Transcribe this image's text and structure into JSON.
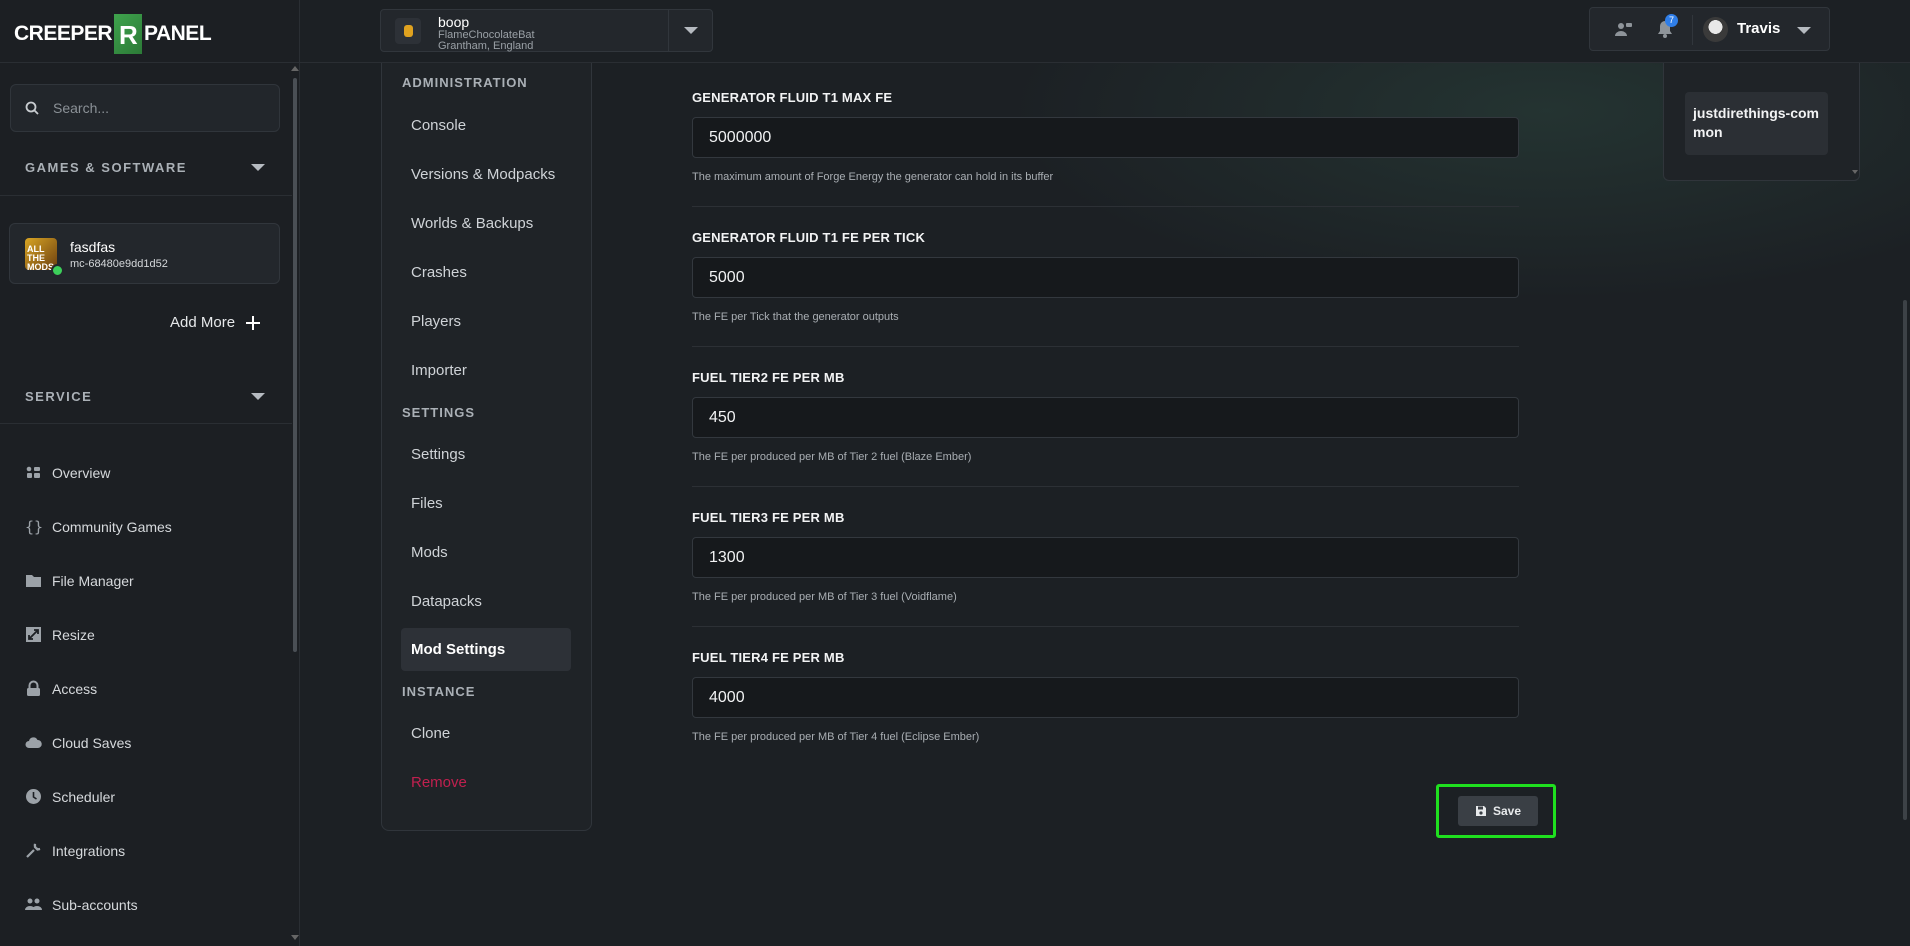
{
  "brand": {
    "logo_left": "CREEPER",
    "logo_right": "PANEL"
  },
  "search": {
    "placeholder": "Search..."
  },
  "sidebar": {
    "games_section": "GAMES & SOFTWARE",
    "server": {
      "name": "fasdfas",
      "id": "mc-68480e9dd1d52",
      "thumb_text": "ALL THE MODS"
    },
    "add_more": "Add More",
    "service_section": "SERVICE",
    "items": [
      {
        "label": "Overview",
        "icon": "grid-icon"
      },
      {
        "label": "Community Games",
        "icon": "braces-icon"
      },
      {
        "label": "File Manager",
        "icon": "folder-icon"
      },
      {
        "label": "Resize",
        "icon": "resize-icon"
      },
      {
        "label": "Access",
        "icon": "lock-icon"
      },
      {
        "label": "Cloud Saves",
        "icon": "cloud-icon"
      },
      {
        "label": "Scheduler",
        "icon": "clock-icon"
      },
      {
        "label": "Integrations",
        "icon": "wrench-icon"
      },
      {
        "label": "Sub-accounts",
        "icon": "users-icon"
      }
    ]
  },
  "header": {
    "server_name": "boop",
    "server_host": "FlameChocolateBat",
    "server_location": "Grantham, England",
    "notifications": "7",
    "username": "Travis"
  },
  "subnav": {
    "administration": "ADMINISTRATION",
    "admin_items": [
      "Console",
      "Versions & Modpacks",
      "Worlds & Backups",
      "Crashes",
      "Players",
      "Importer"
    ],
    "settings": "SETTINGS",
    "settings_items": [
      "Settings",
      "Files",
      "Mods",
      "Datapacks",
      "Mod Settings"
    ],
    "instance": "INSTANCE",
    "instance_items": [
      "Clone",
      "Remove"
    ]
  },
  "form": {
    "fields": [
      {
        "label": "GENERATOR FLUID T1 MAX FE",
        "value": "5000000",
        "help": "The maximum amount of Forge Energy the generator can hold in its buffer"
      },
      {
        "label": "GENERATOR FLUID T1 FE PER TICK",
        "value": "5000",
        "help": "The FE per Tick that the generator outputs"
      },
      {
        "label": "FUEL TIER2 FE PER MB",
        "value": "450",
        "help": "The FE per produced per MB of Tier 2 fuel (Blaze Ember)"
      },
      {
        "label": "FUEL TIER3 FE PER MB",
        "value": "1300",
        "help": "The FE per produced per MB of Tier 3 fuel (Voidflame)"
      },
      {
        "label": "FUEL TIER4 FE PER MB",
        "value": "4000",
        "help": "The FE per produced per MB of Tier 4 fuel (Eclipse Ember)"
      }
    ],
    "save_label": "Save"
  },
  "right_panel": {
    "selected_mod": "justdirethings-common"
  },
  "colors": {
    "accent_green": "#1fe01f",
    "danger": "#c0204f",
    "badge": "#2f7ee8"
  }
}
